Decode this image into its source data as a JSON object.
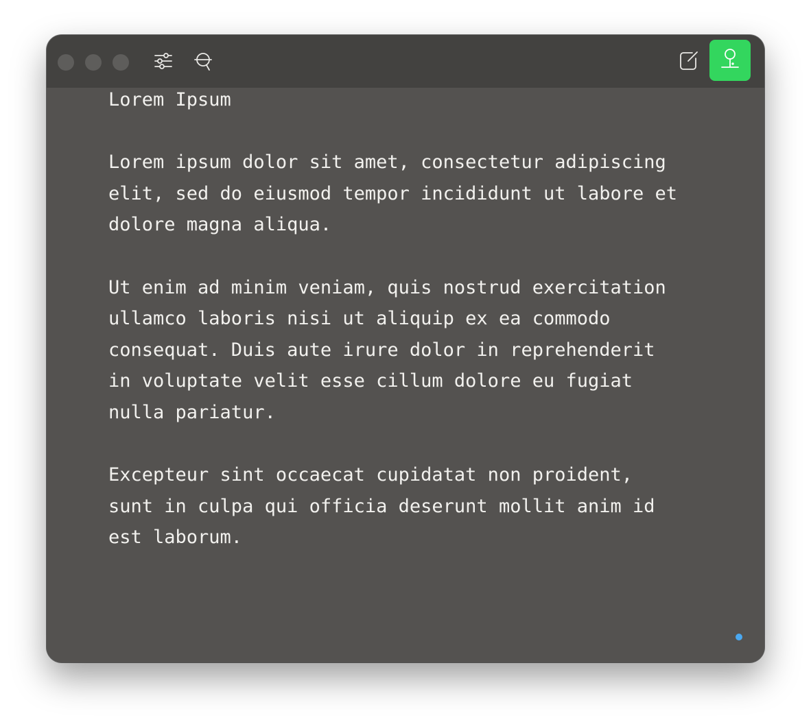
{
  "window": {
    "traffic_lights": [
      "close",
      "minimize",
      "zoom"
    ],
    "toolbar": {
      "left_icons": [
        "sliders-icon",
        "search-icon"
      ],
      "right_icons": [
        "compose-icon",
        "focus-pin-icon"
      ]
    },
    "colors": {
      "background": "#545250",
      "titlebar": "#434240",
      "text": "#f2f1ee",
      "accent_green": "#33d65e",
      "status_dot": "#4aa8f0"
    }
  },
  "document": {
    "lines": [
      "Lorem Ipsum",
      "",
      "Lorem ipsum dolor sit amet, consectetur adipiscing",
      "elit, sed do eiusmod tempor incididunt ut labore et",
      "dolore magna aliqua.",
      "",
      "Ut enim ad minim veniam, quis nostrud exercitation",
      "ullamco laboris nisi ut aliquip ex ea commodo",
      "consequat. Duis aute irure dolor in reprehenderit",
      "in voluptate velit esse cillum dolore eu fugiat",
      "nulla pariatur.",
      "",
      "Excepteur sint occaecat cupidatat non proident,",
      "sunt in culpa qui officia deserunt mollit anim id",
      "est laborum."
    ]
  }
}
